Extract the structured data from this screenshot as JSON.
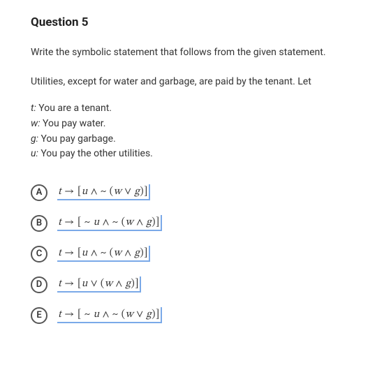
{
  "question": {
    "title": "Question 5",
    "prompt": "Write the symbolic statement that follows from the given statement.",
    "context": "Utilities, except for water and garbage, are paid by the tenant. Let",
    "defs": {
      "t": {
        "var": "t:",
        "text": " You are a tenant."
      },
      "w": {
        "var": "w:",
        "text": " You pay water."
      },
      "g": {
        "var": "g:",
        "text": " You pay garbage."
      },
      "u": {
        "var": "u:",
        "text": " You pay the other utilities."
      }
    },
    "options": {
      "A": {
        "letter": "A",
        "formula_html": "<span class='it'>t</span> → [<span class='it'>u</span> ∧ ~ (<span class='it'>w</span> ∨ <span class='it'>g</span>)]"
      },
      "B": {
        "letter": "B",
        "formula_html": "<span class='it'>t</span> → [ ~ <span class='it'>u</span> ∧ ~ (<span class='it'>w</span> ∧ <span class='it'>g</span>)]"
      },
      "C": {
        "letter": "C",
        "formula_html": "<span class='it'>t</span> → [<span class='it'>u</span> ∧ ~ (<span class='it'>w</span> ∧ <span class='it'>g</span>)]"
      },
      "D": {
        "letter": "D",
        "formula_html": "<span class='it'>t</span> → [<span class='it'>u</span> ∨ (<span class='it'>w</span> ∧ <span class='it'>g</span>)]"
      },
      "E": {
        "letter": "E",
        "formula_html": "<span class='it'>t</span> → [ ~ <span class='it'>u</span> ∧ ~ (<span class='it'>w</span> ∨ <span class='it'>g</span>)]"
      }
    }
  }
}
